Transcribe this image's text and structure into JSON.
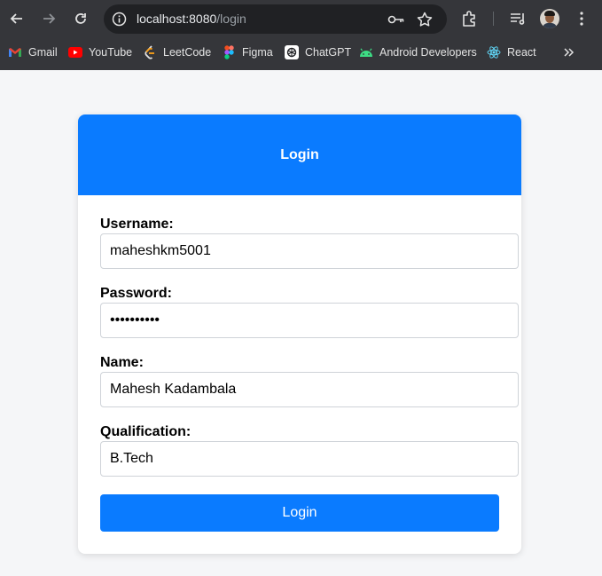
{
  "browser": {
    "url_host": "localhost:8080",
    "url_path": "/login",
    "bookmarks": [
      {
        "label": "Gmail",
        "icon": "gmail-icon"
      },
      {
        "label": "YouTube",
        "icon": "youtube-icon"
      },
      {
        "label": "LeetCode",
        "icon": "leetcode-icon"
      },
      {
        "label": "Figma",
        "icon": "figma-icon"
      },
      {
        "label": "ChatGPT",
        "icon": "chatgpt-icon"
      },
      {
        "label": "Android Developers",
        "icon": "android-icon"
      },
      {
        "label": "React",
        "icon": "react-icon"
      }
    ],
    "more_bookmarks": "»"
  },
  "form": {
    "title": "Login",
    "fields": [
      {
        "label": "Username:",
        "value": "maheshkm5001"
      },
      {
        "label": "Password:",
        "value": "••••••••••"
      },
      {
        "label": "Name:",
        "value": "Mahesh Kadambala"
      },
      {
        "label": "Qualification:",
        "value": "B.Tech"
      }
    ],
    "submit_label": "Login"
  },
  "colors": {
    "primary": "#0a7bff",
    "chrome_bg": "#35363a",
    "page_bg": "#f5f6f8"
  }
}
